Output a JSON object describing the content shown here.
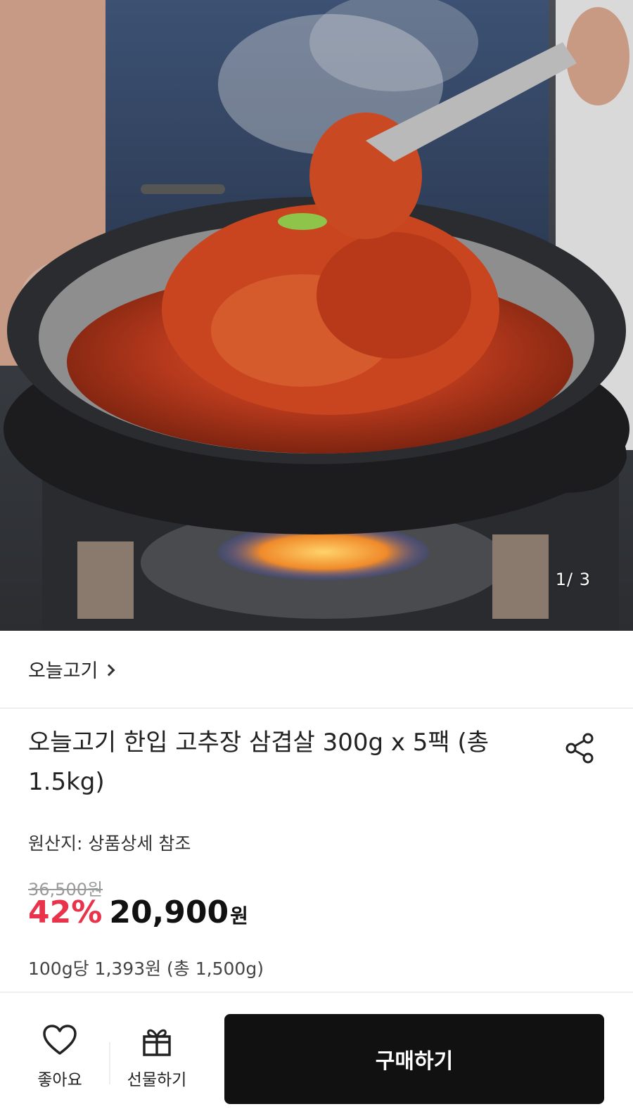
{
  "gallery": {
    "counter": "1/ 3"
  },
  "brand": {
    "name": "오늘고기",
    "chevron_icon": "chevron-right-icon"
  },
  "product": {
    "title": "오늘고기 한입 고추장 삼겹살 300g x 5팩 (총 1.5kg)",
    "share_icon": "share-icon",
    "origin": "원산지: 상품상세 참조",
    "original_price": "36,500원",
    "discount": "42%",
    "price": "20,900",
    "currency": "원",
    "unit_price": "100g당 1,393원 (총 1,500g)"
  },
  "bottom_bar": {
    "like_label": "좋아요",
    "like_icon": "heart-icon",
    "gift_label": "선물하기",
    "gift_icon": "gift-icon",
    "buy_label": "구매하기"
  },
  "colors": {
    "discount": "#e8334a",
    "buy_button": "#111111"
  }
}
